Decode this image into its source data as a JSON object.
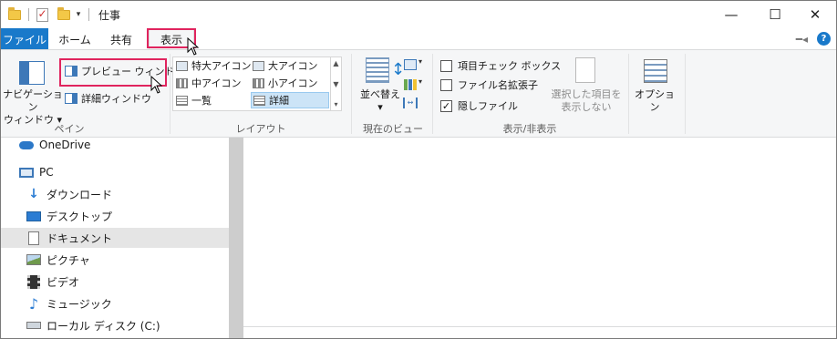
{
  "window": {
    "title": "仕事"
  },
  "titlebar": {
    "quick_access": [
      "folder-icon",
      "properties-icon",
      "new-folder-icon",
      "customize-chevron-icon"
    ],
    "buttons": {
      "minimize": "—",
      "maximize": "☐",
      "close": "✕"
    }
  },
  "tabs": [
    {
      "label": "ファイル"
    },
    {
      "label": "ホーム"
    },
    {
      "label": "共有"
    },
    {
      "label": "表示"
    }
  ],
  "active_tab": "表示",
  "ribbon": {
    "panes": {
      "nav_pane_line1": "ナビゲーション",
      "nav_pane_line2": "ウィンドウ",
      "preview_pane": "プレビュー ウィンドウ",
      "details_pane": "詳細ウィンドウ",
      "group_label": "ペイン"
    },
    "layout": {
      "items": [
        "特大アイコン",
        "大アイコン",
        "中アイコン",
        "小アイコン",
        "一覧",
        "詳細"
      ],
      "selected": "詳細",
      "group_label": "レイアウト"
    },
    "current_view": {
      "sort_by": "並べ替え",
      "group_label": "現在のビュー"
    },
    "show_hide": {
      "item_checkboxes": {
        "label": "項目チェック ボックス",
        "checked": false
      },
      "file_extensions": {
        "label": "ファイル名拡張子",
        "checked": false
      },
      "hidden_items": {
        "label": "隠しファイル",
        "checked": true
      },
      "hide_selected_line1": "選択した項目を",
      "hide_selected_line2": "表示しない",
      "group_label": "表示/非表示"
    },
    "options": {
      "label": "オプション"
    }
  },
  "nav": {
    "items": [
      {
        "label": "OneDrive",
        "icon": "onedrive-icon"
      },
      {
        "label": "PC",
        "icon": "pc-icon"
      },
      {
        "label": "ダウンロード",
        "icon": "download-icon"
      },
      {
        "label": "デスクトップ",
        "icon": "desktop-icon"
      },
      {
        "label": "ドキュメント",
        "icon": "documents-icon"
      },
      {
        "label": "ピクチャ",
        "icon": "pictures-icon"
      },
      {
        "label": "ビデオ",
        "icon": "videos-icon"
      },
      {
        "label": "ミュージック",
        "icon": "music-icon"
      },
      {
        "label": "ローカル ディスク (C:)",
        "icon": "local-disk-icon"
      }
    ],
    "selected": "ドキュメント"
  },
  "colors": {
    "file_tab": "#1979ca",
    "highlight_box": "#e0245e",
    "ribbon_bg": "#f5f6f7",
    "selected_layout": "#cce4f7"
  }
}
